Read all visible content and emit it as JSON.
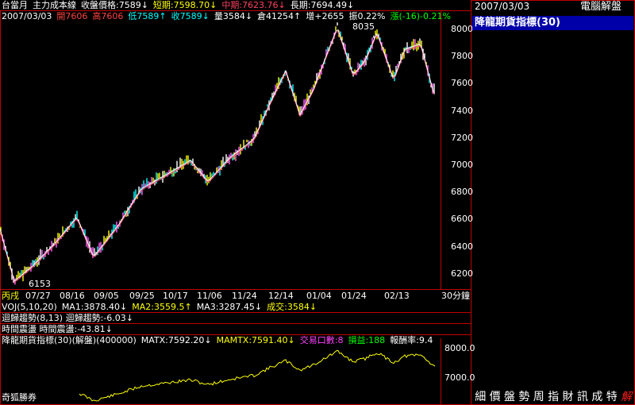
{
  "header": {
    "row1": [
      {
        "text": "台當月",
        "color": "#ffffff"
      },
      {
        "text": "主力成本線",
        "color": "#ffffff"
      },
      {
        "text": "收盤價格:7589↓",
        "color": "#ffffff"
      },
      {
        "text": "短期:7598.70↓",
        "color": "#ffff00"
      },
      {
        "text": "中期:7623.76↓",
        "color": "#ff4060"
      },
      {
        "text": "長期:7694.49↓",
        "color": "#ffffff"
      }
    ],
    "row2": [
      {
        "text": "2007/03/03",
        "color": "#ffffff"
      },
      {
        "text": "開7606",
        "color": "#ff4040"
      },
      {
        "text": "高7606",
        "color": "#ff4040"
      },
      {
        "text": "低7589↑",
        "color": "#00ffff"
      },
      {
        "text": "收7589↓",
        "color": "#00ffff"
      },
      {
        "text": "量3584↓",
        "color": "#ffffff"
      },
      {
        "text": "倉41254↑",
        "color": "#ffffff"
      },
      {
        "text": "增+2655",
        "color": "#ffffff"
      },
      {
        "text": "振0.22%",
        "color": "#ffffff"
      },
      {
        "text": "漲(-16)-0.21%",
        "color": "#00ff00"
      }
    ]
  },
  "main_chart": {
    "y_ticks": [
      "8000",
      "7800",
      "7600",
      "7400",
      "7200",
      "7000",
      "6800",
      "6600",
      "6400",
      "6200"
    ],
    "x_ticks": [
      "丙戌",
      "07/27",
      "08/16",
      "09/05",
      "09/25",
      "10/17",
      "11/06",
      "11/24",
      "12/14",
      "01/04",
      "01/24",
      "02/13"
    ],
    "period_label": "30分鐘",
    "high_marker": "8035",
    "low_marker": "6153"
  },
  "indicators": {
    "voj": [
      {
        "text": "VOJ(5,10,20)",
        "color": "#ffffff"
      },
      {
        "text": "MA1:3878.40↓",
        "color": "#ffffff"
      },
      {
        "text": "MA2:3559.5↑",
        "color": "#ffff00"
      },
      {
        "text": "MA3:3287.45↓",
        "color": "#ffffff"
      },
      {
        "text": "成交:3584↓",
        "color": "#ffff00"
      }
    ],
    "trend_label": "迴歸趨勢(8,13)",
    "trend_value": "迴歸趨勢:-6.03↓",
    "time_label": "時間震盪",
    "time_value": "時間震盪:-43.81↓",
    "bottom": [
      {
        "text": "降龍期貨指標(30)(解盤)(400000)",
        "color": "#ffffff"
      },
      {
        "text": "MATX:7592.20↓",
        "color": "#ffffff"
      },
      {
        "text": "MAMTX:7591.40↓",
        "color": "#ffff00"
      },
      {
        "text": "交易口數:8",
        "color": "#ff40ff"
      },
      {
        "text": "損益:188",
        "color": "#00ff00"
      },
      {
        "text": "報酬率:9.4",
        "color": "#ffffff"
      }
    ],
    "sub_y_ticks": [
      "8000.0",
      "7000.0"
    ]
  },
  "sidebar": {
    "date": "2007/03/03",
    "title": "電腦解盤",
    "indicator_name": "降龍期貨指標(30)",
    "tabs": [
      "細",
      "價",
      "盤",
      "勢",
      "周",
      "指",
      "財",
      "訊",
      "成",
      "特",
      "解"
    ]
  },
  "footer": {
    "broker": "奇狐勝券"
  },
  "colors": {
    "frame": "#c00000",
    "line_yellow": "#ffff00",
    "line_pink": "#ff5080",
    "line_white": "#ffffff",
    "tab_highlight": "#ff2020"
  }
}
